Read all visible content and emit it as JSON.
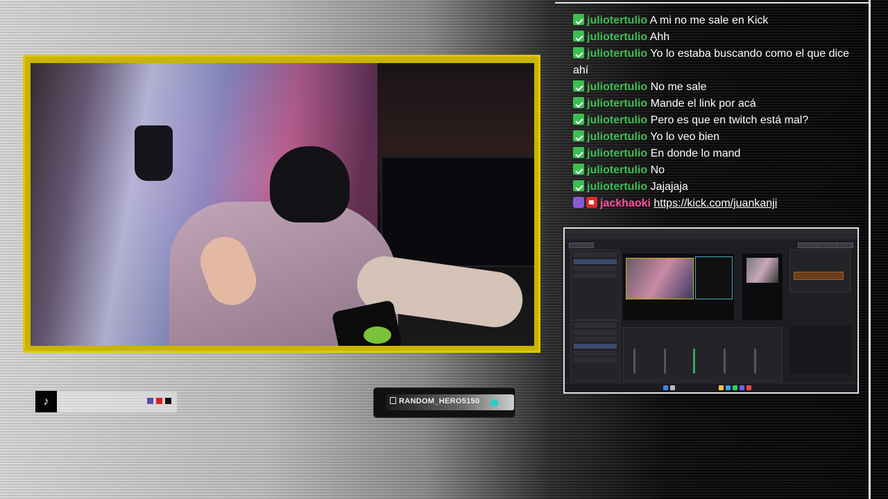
{
  "chat": {
    "messages": [
      {
        "user": "juliotertulio",
        "text": "A mi no me sale en Kick"
      },
      {
        "user": "juliotertulio",
        "text": "Ahh"
      },
      {
        "user": "juliotertulio",
        "text": "Yo lo estaba buscando como el que dice ahí"
      },
      {
        "user": "juliotertulio",
        "text": "No me sale"
      },
      {
        "user": "juliotertulio",
        "text": "Mande el link por acá"
      },
      {
        "user": "juliotertulio",
        "text": "Pero es que en twitch está mal?"
      },
      {
        "user": "juliotertulio",
        "text": "Yo lo veo bien"
      },
      {
        "user": "juliotertulio",
        "text": "En donde lo mand"
      },
      {
        "user": "juliotertulio",
        "text": "No"
      },
      {
        "user": "juliotertulio",
        "text": "Jajajaja"
      }
    ],
    "last": {
      "user": "jackhaoki",
      "link": "https://kick.com/juankanji"
    }
  },
  "footer": {
    "tiktok_icon": "tiktok-icon",
    "twitch_handle": "RANDOM_HERO5150",
    "colors": {
      "accent_frame": "#e2c700",
      "chat_user": "#3ebd53",
      "chat_user2": "#ff4fa3"
    }
  }
}
